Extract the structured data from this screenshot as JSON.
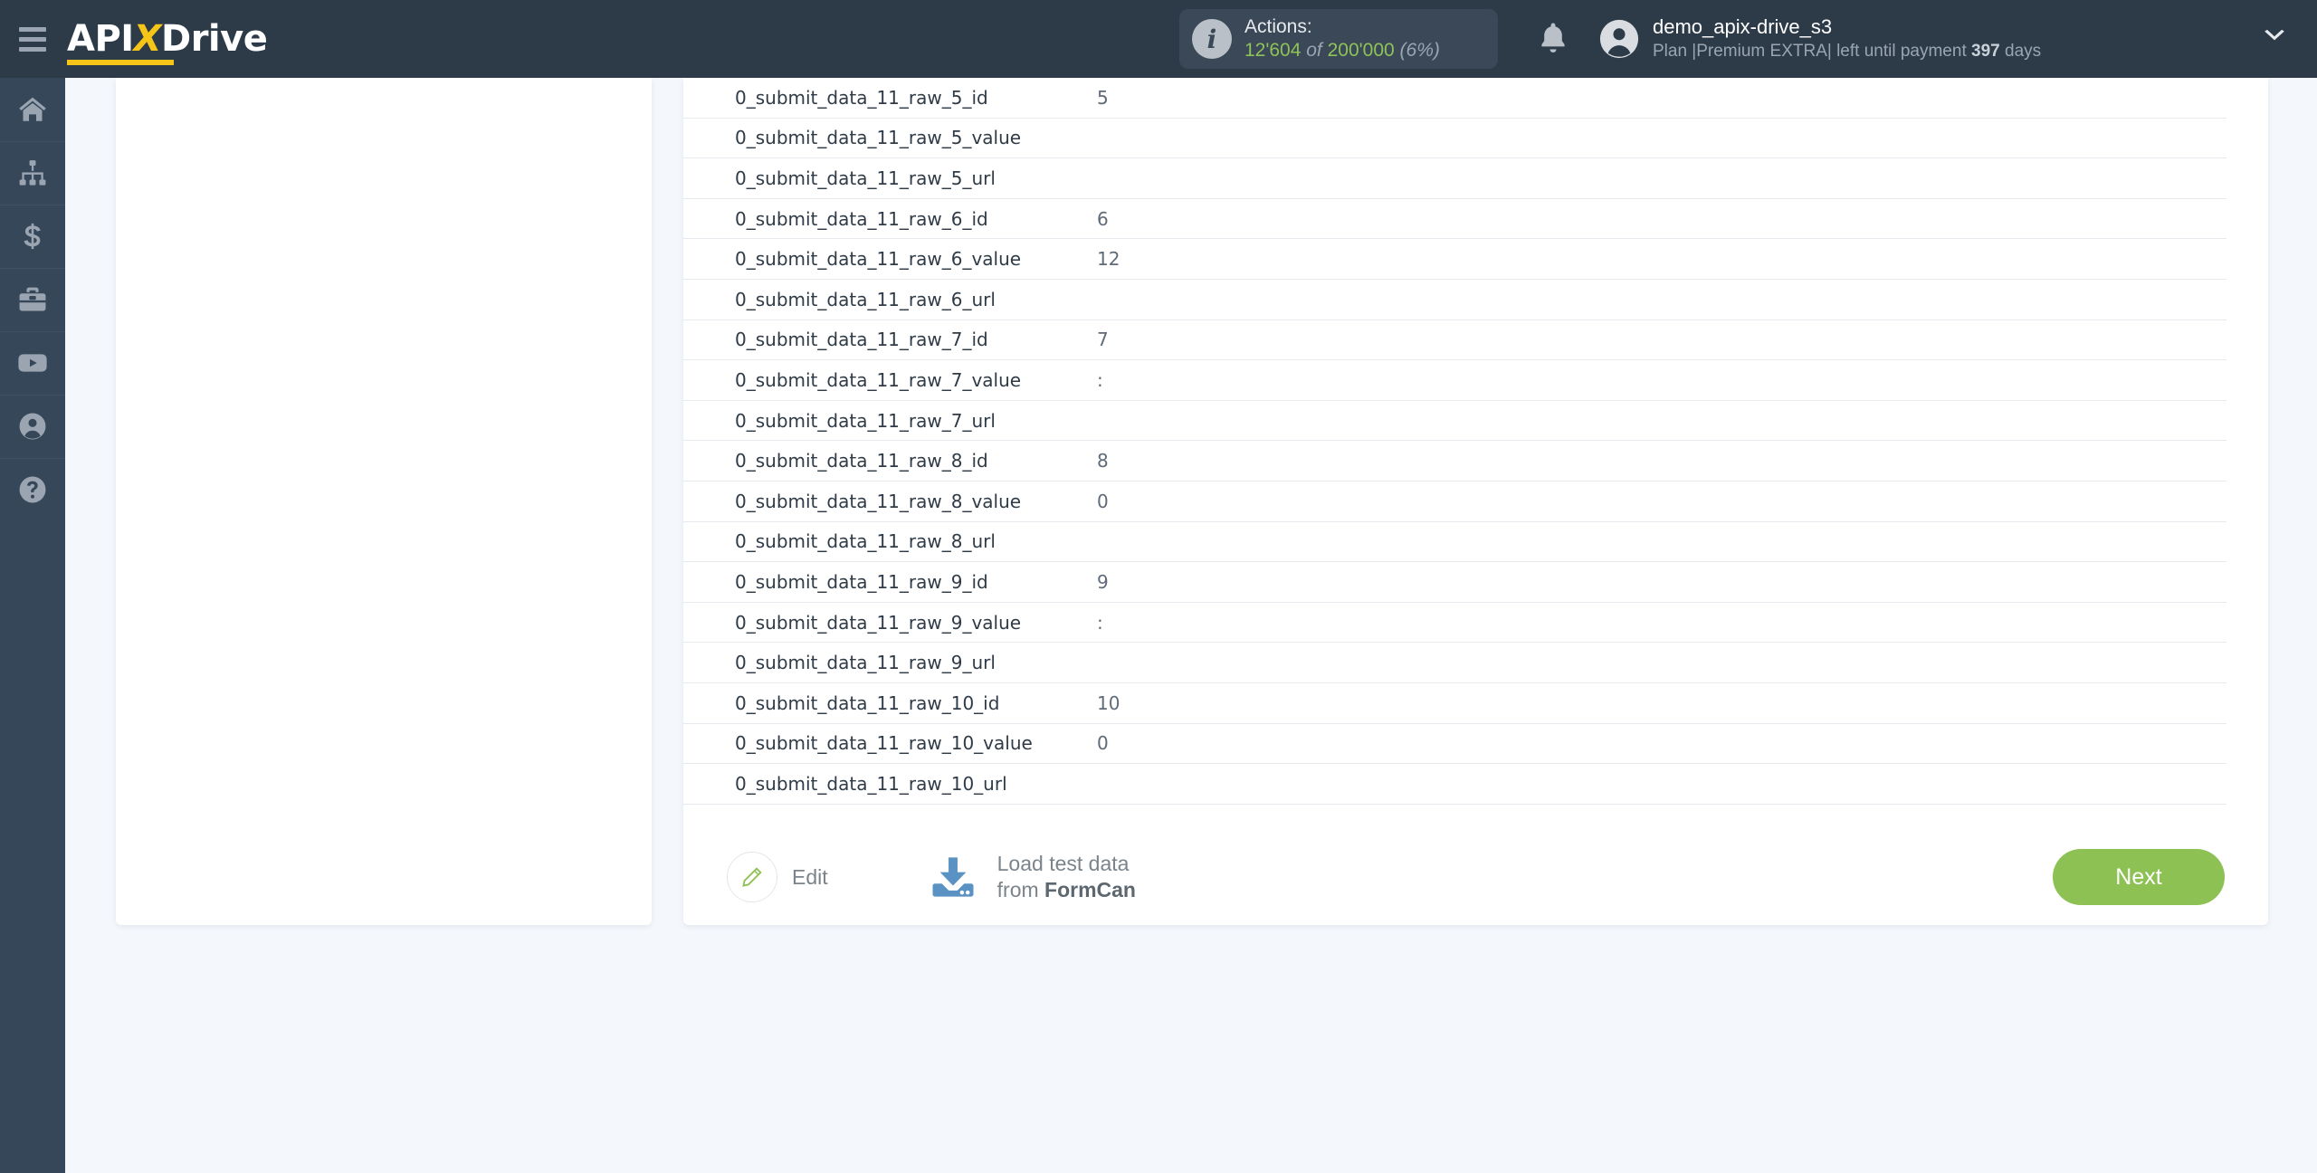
{
  "header": {
    "logo_text_api": "API",
    "logo_text_x": "X",
    "logo_text_drive": "Drive",
    "menu_icon": "hamburger-icon",
    "actions": {
      "label": "Actions:",
      "used": "12'604",
      "of": "of",
      "total": "200'000",
      "percent": "(6%)"
    },
    "notifications_icon": "bell-icon",
    "account": {
      "name": "demo_apix-drive_s3",
      "plan_prefix": "Plan |Premium EXTRA| left until payment ",
      "plan_days": "397",
      "plan_suffix": " days"
    },
    "dropdown_icon": "chevron-down-icon"
  },
  "sidebar": {
    "items": [
      {
        "name": "home",
        "icon": "home-icon"
      },
      {
        "name": "connections",
        "icon": "sitemap-icon"
      },
      {
        "name": "billing",
        "icon": "dollar-icon"
      },
      {
        "name": "business",
        "icon": "briefcase-icon"
      },
      {
        "name": "video",
        "icon": "youtube-icon"
      },
      {
        "name": "profile",
        "icon": "user-icon"
      },
      {
        "name": "help",
        "icon": "question-icon"
      }
    ]
  },
  "table": {
    "rows": [
      {
        "key": "0_submit_data_11_raw_5_id",
        "value": "5"
      },
      {
        "key": "0_submit_data_11_raw_5_value",
        "value": ""
      },
      {
        "key": "0_submit_data_11_raw_5_url",
        "value": ""
      },
      {
        "key": "0_submit_data_11_raw_6_id",
        "value": "6"
      },
      {
        "key": "0_submit_data_11_raw_6_value",
        "value": "12"
      },
      {
        "key": "0_submit_data_11_raw_6_url",
        "value": ""
      },
      {
        "key": "0_submit_data_11_raw_7_id",
        "value": "7"
      },
      {
        "key": "0_submit_data_11_raw_7_value",
        "value": ":"
      },
      {
        "key": "0_submit_data_11_raw_7_url",
        "value": ""
      },
      {
        "key": "0_submit_data_11_raw_8_id",
        "value": "8"
      },
      {
        "key": "0_submit_data_11_raw_8_value",
        "value": "0"
      },
      {
        "key": "0_submit_data_11_raw_8_url",
        "value": ""
      },
      {
        "key": "0_submit_data_11_raw_9_id",
        "value": "9"
      },
      {
        "key": "0_submit_data_11_raw_9_value",
        "value": ":"
      },
      {
        "key": "0_submit_data_11_raw_9_url",
        "value": ""
      },
      {
        "key": "0_submit_data_11_raw_10_id",
        "value": "10"
      },
      {
        "key": "0_submit_data_11_raw_10_value",
        "value": "0"
      },
      {
        "key": "0_submit_data_11_raw_10_url",
        "value": ""
      }
    ]
  },
  "footer": {
    "edit_label": "Edit",
    "edit_icon": "pencil-icon",
    "load_icon": "download-icon",
    "load_line1": "Load test data",
    "load_line2_prefix": "from ",
    "load_line2_service": "FormCan",
    "next_label": "Next"
  },
  "colors": {
    "header_bg": "#2d3b49",
    "rail_bg": "#36475a",
    "page_bg": "#f4f7fb",
    "accent_yellow": "#f5c518",
    "accent_green": "#8dc153",
    "accent_blue": "#5b92c4"
  }
}
